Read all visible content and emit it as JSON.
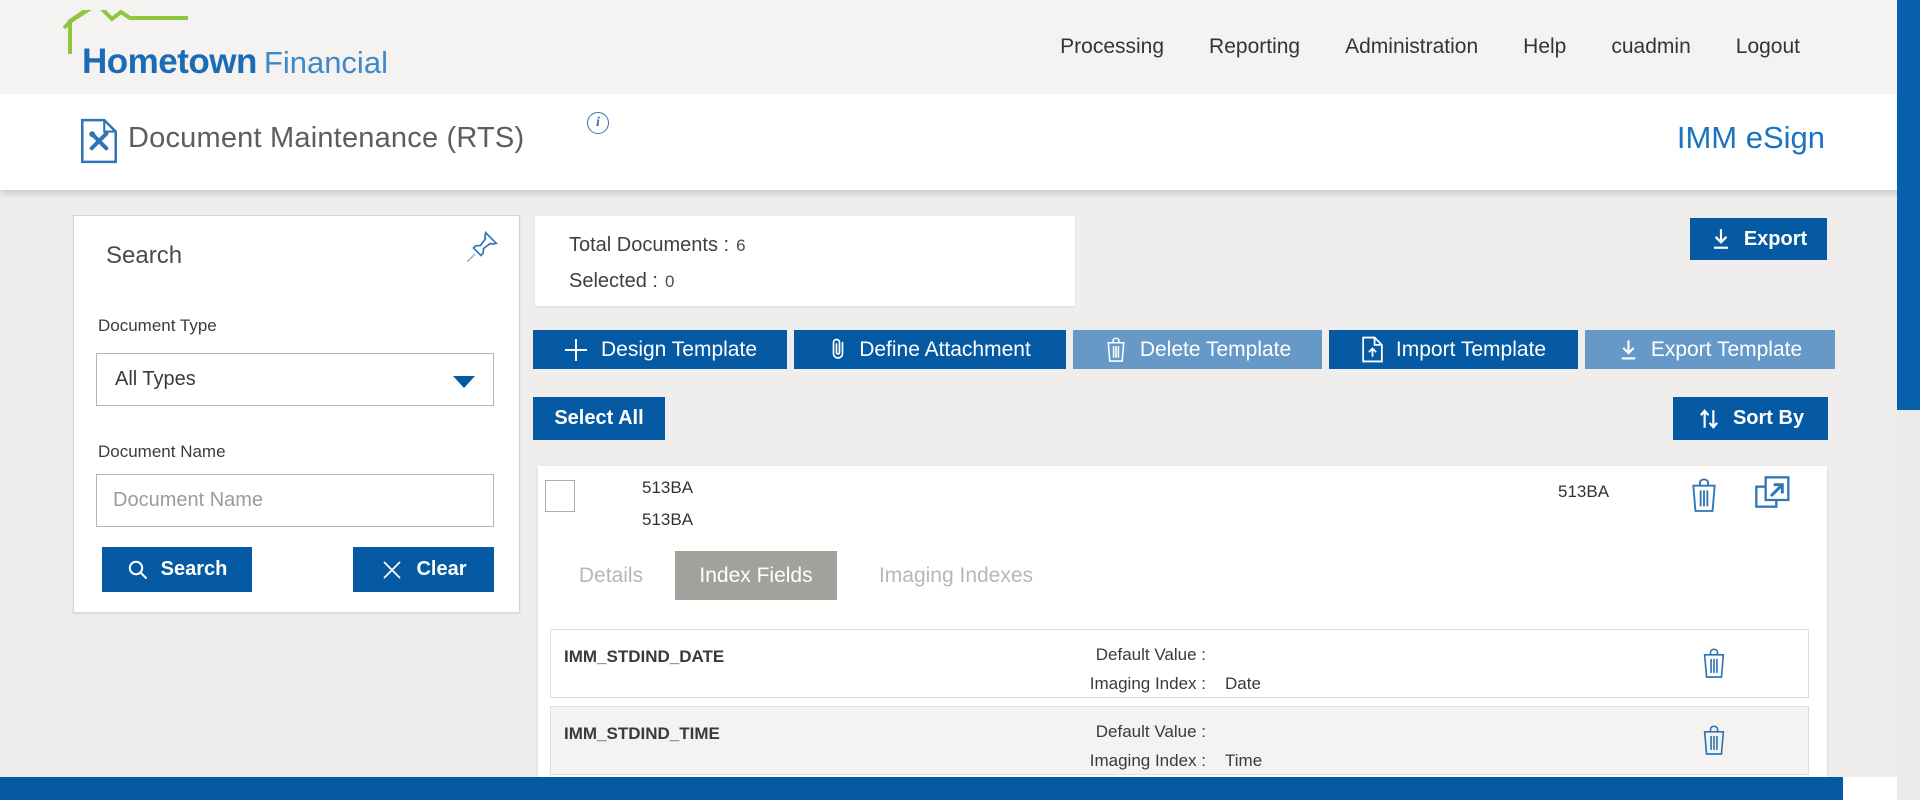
{
  "brand": {
    "name_bold": "Hometown",
    "name_light": "Financial",
    "product": "IMM eSign"
  },
  "nav": {
    "items": [
      "Processing",
      "Reporting",
      "Administration",
      "Help",
      "cuadmin",
      "Logout"
    ]
  },
  "page": {
    "title": "Document Maintenance (RTS)",
    "info_icon_glyph": "i"
  },
  "search_panel": {
    "title": "Search",
    "document_type_label": "Document Type",
    "document_type_value": "All Types",
    "document_name_label": "Document Name",
    "document_name_placeholder": "Document Name",
    "search_button": "Search",
    "clear_button": "Clear"
  },
  "summary": {
    "total_label": "Total Documents :",
    "total_value": "6",
    "selected_label": "Selected :",
    "selected_value": "0"
  },
  "toolbar": {
    "export_label": "Export",
    "buttons": [
      {
        "label": "Design Template",
        "icon": "plus",
        "enabled": true
      },
      {
        "label": "Define Attachment",
        "icon": "paperclip",
        "enabled": true
      },
      {
        "label": "Delete Template",
        "icon": "trash",
        "enabled": false
      },
      {
        "label": "Import Template",
        "icon": "import-document",
        "enabled": true
      },
      {
        "label": "Export Template",
        "icon": "download",
        "enabled": false
      }
    ],
    "select_all_label": "Select All",
    "sort_by_label": "Sort By"
  },
  "document": {
    "name_line1": "513BA",
    "name_line2": "513BA",
    "code": "513BA",
    "selected": false,
    "tabs": [
      {
        "label": "Details",
        "active": false
      },
      {
        "label": "Index Fields",
        "active": true
      },
      {
        "label": "Imaging Indexes",
        "active": false
      }
    ],
    "index_fields": [
      {
        "name": "IMM_STDIND_DATE",
        "default_value_label": "Default Value :",
        "default_value": "",
        "imaging_index_label": "Imaging Index :",
        "imaging_index": "Date"
      },
      {
        "name": "IMM_STDIND_TIME",
        "default_value_label": "Default Value :",
        "default_value": "",
        "imaging_index_label": "Imaging Index :",
        "imaging_index": "Time"
      }
    ]
  },
  "colors": {
    "primary_blue": "#0659a3",
    "disabled_blue": "#6699c7",
    "brand_blue": "#1b6cb5",
    "brand_light_blue": "#3f89c8",
    "logo_green": "#8ec63f",
    "icon_blue": "#2e75b6",
    "tab_active_bg": "#a3a19c",
    "page_bg": "#efeeec"
  }
}
